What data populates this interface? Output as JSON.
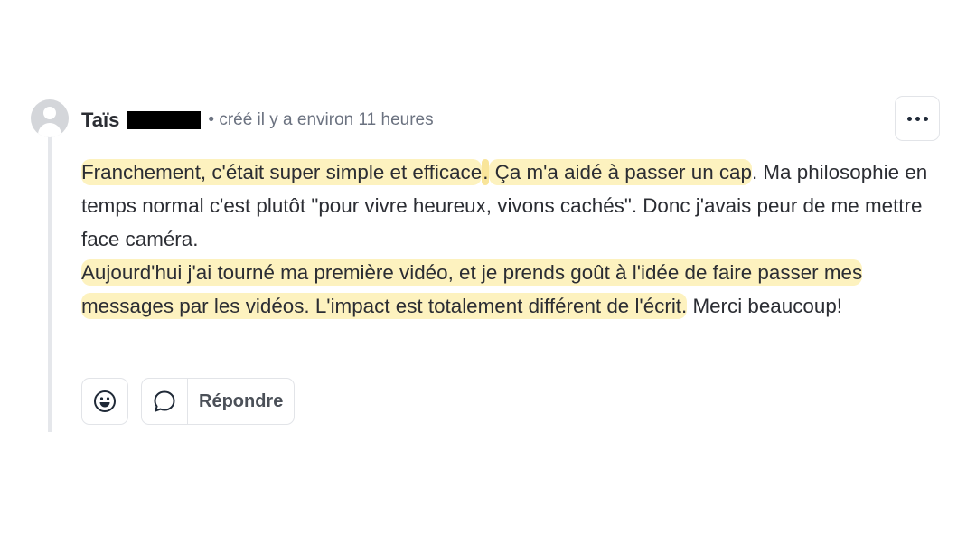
{
  "comment": {
    "author": "Taïs",
    "meta": "• créé il y a environ 11 heures",
    "more_icon": "more-horizontal-icon",
    "body": {
      "p1_hl1": "Franchement, c'était super simple et efficace",
      "p1_hl1_dot": ".",
      "p1_hl2": " Ça m'a aidé à passer un cap",
      "p1_plain": ". Ma philosophie en temps normal c'est plutôt \"pour vivre heureux, vivons cachés\". Donc j'avais peur de me mettre face caméra.",
      "p2_hl": "Aujourd'hui j'ai tourné ma première vidéo, et je prends goût à l'idée de faire passer mes messages par les vidéos. L'impact est totalement différent de l'écrit.",
      "p2_plain": " Merci beaucoup!"
    },
    "actions": {
      "emoji_icon": "emoji-smile-icon",
      "reply_icon": "speech-bubble-icon",
      "reply_label": "Répondre"
    }
  },
  "colors": {
    "highlight": "#fdf2bf",
    "text": "#2b2d33",
    "muted": "#6b7280",
    "border": "#e2e4e8"
  }
}
